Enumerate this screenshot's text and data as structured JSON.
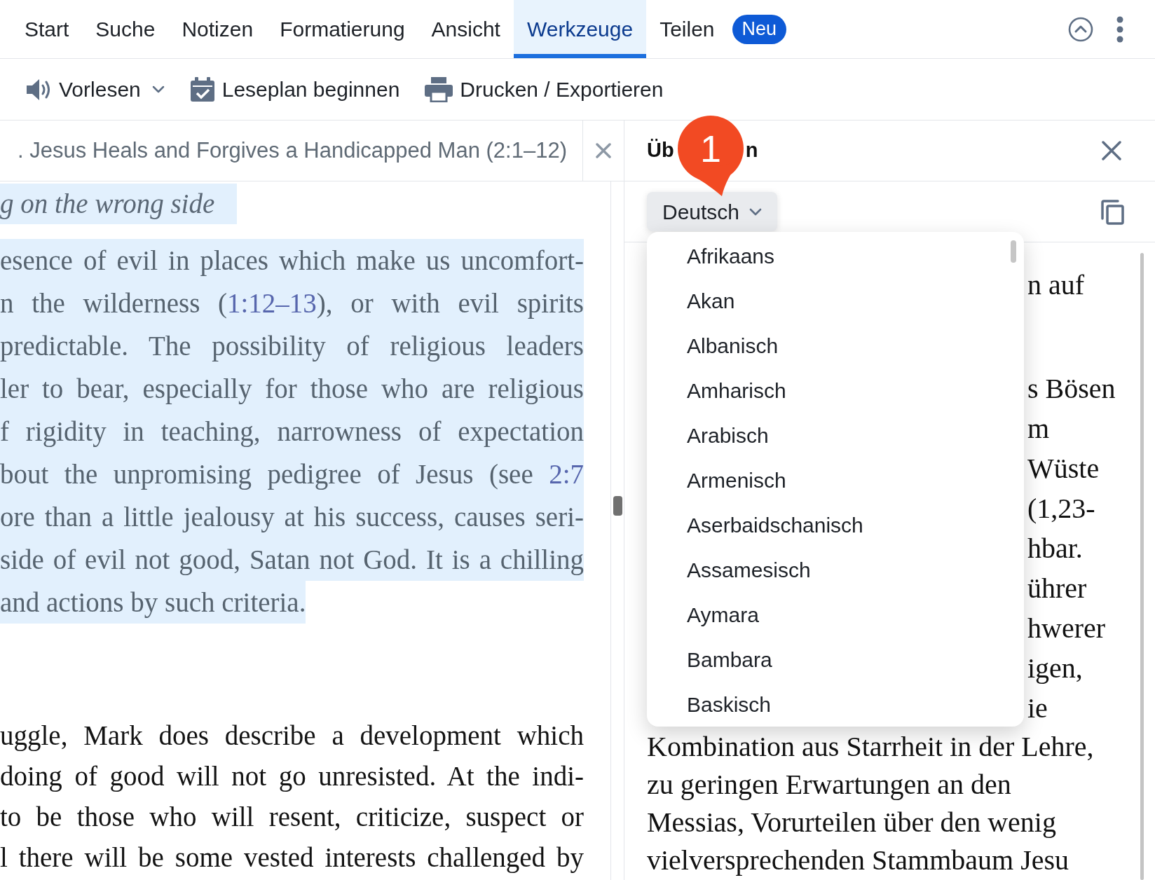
{
  "ribbon_tabs": [
    {
      "label": "Start",
      "selected": false
    },
    {
      "label": "Suche",
      "selected": false
    },
    {
      "label": "Notizen",
      "selected": false
    },
    {
      "label": "Formatierung",
      "selected": false
    },
    {
      "label": "Ansicht",
      "selected": false
    },
    {
      "label": "Werkzeuge",
      "selected": true
    },
    {
      "label": "Teilen",
      "selected": false,
      "badge": "Neu"
    }
  ],
  "toolbar": [
    {
      "label": "Vorlesen",
      "kind": "dropdown"
    },
    {
      "label": "Leseplan beginnen",
      "kind": "button"
    },
    {
      "label": "Drucken / Exportieren",
      "kind": "button"
    }
  ],
  "reader": {
    "tab_title": ". Jesus Heals and Forgives a Handicapped Man (2:1–12)",
    "blocks": [
      {
        "kind": "heading",
        "highlighted": true,
        "lines": [
          [
            {
              "kind": "text",
              "text": "g on the wrong side"
            }
          ]
        ]
      },
      {
        "kind": "paragraph",
        "highlighted": true,
        "continues_below": false,
        "lines": [
          [
            {
              "kind": "text",
              "text": "esence of evil in places which make us uncomfort-"
            }
          ],
          [
            {
              "kind": "text",
              "text": "n the wilderness ("
            },
            {
              "kind": "link",
              "text": "1:12–13"
            },
            {
              "kind": "text",
              "text": "), or with evil spirits"
            }
          ],
          [
            {
              "kind": "text",
              "text": "predictable. The possibility of religious leaders"
            }
          ],
          [
            {
              "kind": "text",
              "text": "ler to bear, especially for those who are religious"
            }
          ],
          [
            {
              "kind": "text",
              "text": "f rigidity in teaching, narrowness of expectation"
            }
          ],
          [
            {
              "kind": "text",
              "text": "bout the unpromising pedigree of Jesus (see "
            },
            {
              "kind": "link",
              "text": "2:7"
            }
          ],
          [
            {
              "kind": "text",
              "text": "ore than a little jealousy at his success, causes seri-"
            }
          ],
          [
            {
              "kind": "text",
              "text": "side of evil not good, Satan not God. It is a chilling"
            }
          ],
          [
            {
              "kind": "text",
              "text": "and actions by such criteria."
            }
          ]
        ]
      },
      {
        "kind": "paragraph",
        "highlighted": false,
        "continues_below": true,
        "lines": [
          [
            {
              "kind": "text",
              "text": "uggle, Mark does describe a development which"
            }
          ],
          [
            {
              "kind": "text",
              "text": "doing of good will not go unresisted. At the indi-"
            }
          ],
          [
            {
              "kind": "text",
              "text": "to be those who will resent, criticize, suspect or"
            }
          ],
          [
            {
              "kind": "text",
              "text": "l there will be some vested interests challenged by"
            }
          ]
        ]
      }
    ]
  },
  "panel": {
    "title_parts": [
      "Üb",
      "n"
    ],
    "callout": {
      "label": "1"
    },
    "language_select": {
      "value": "Deutsch",
      "expanded": true,
      "options": [
        {
          "label": "Afrikaans",
          "selected": false
        },
        {
          "label": "Akan",
          "selected": false
        },
        {
          "label": "Albanisch",
          "selected": false
        },
        {
          "label": "Amharisch",
          "selected": false
        },
        {
          "label": "Arabisch",
          "selected": false
        },
        {
          "label": "Armenisch",
          "selected": false
        },
        {
          "label": "Aserbaidschanisch",
          "selected": false
        },
        {
          "label": "Assamesisch",
          "selected": false
        },
        {
          "label": "Aymara",
          "selected": false
        },
        {
          "label": "Bambara",
          "selected": false
        },
        {
          "label": "Baskisch",
          "selected": false
        }
      ]
    },
    "paragraphs": [
      {
        "lines": [
          {
            "kind": "covered",
            "text": "n auf"
          }
        ]
      },
      {
        "lines": [
          {
            "kind": "covered",
            "text": "s Bösen"
          },
          {
            "kind": "covered",
            "text": "m"
          },
          {
            "kind": "covered",
            "text": "Wüste"
          },
          {
            "kind": "covered",
            "text": "(1,23-"
          },
          {
            "kind": "covered",
            "text": "hbar."
          },
          {
            "kind": "covered",
            "text": "ührer"
          },
          {
            "kind": "covered",
            "text": "hwerer"
          },
          {
            "kind": "covered",
            "text": "igen,"
          },
          {
            "kind": "covered",
            "text": "ie"
          },
          {
            "kind": "full",
            "text": "Kombination aus Starrheit in der Lehre,"
          },
          {
            "kind": "full",
            "text": "zu geringen Erwartungen an den"
          },
          {
            "kind": "full",
            "text": "Messias, Vorurteilen über den wenig"
          },
          {
            "kind": "full",
            "text": "vielversprechenden Stammbaum Jesu"
          }
        ]
      }
    ]
  }
}
